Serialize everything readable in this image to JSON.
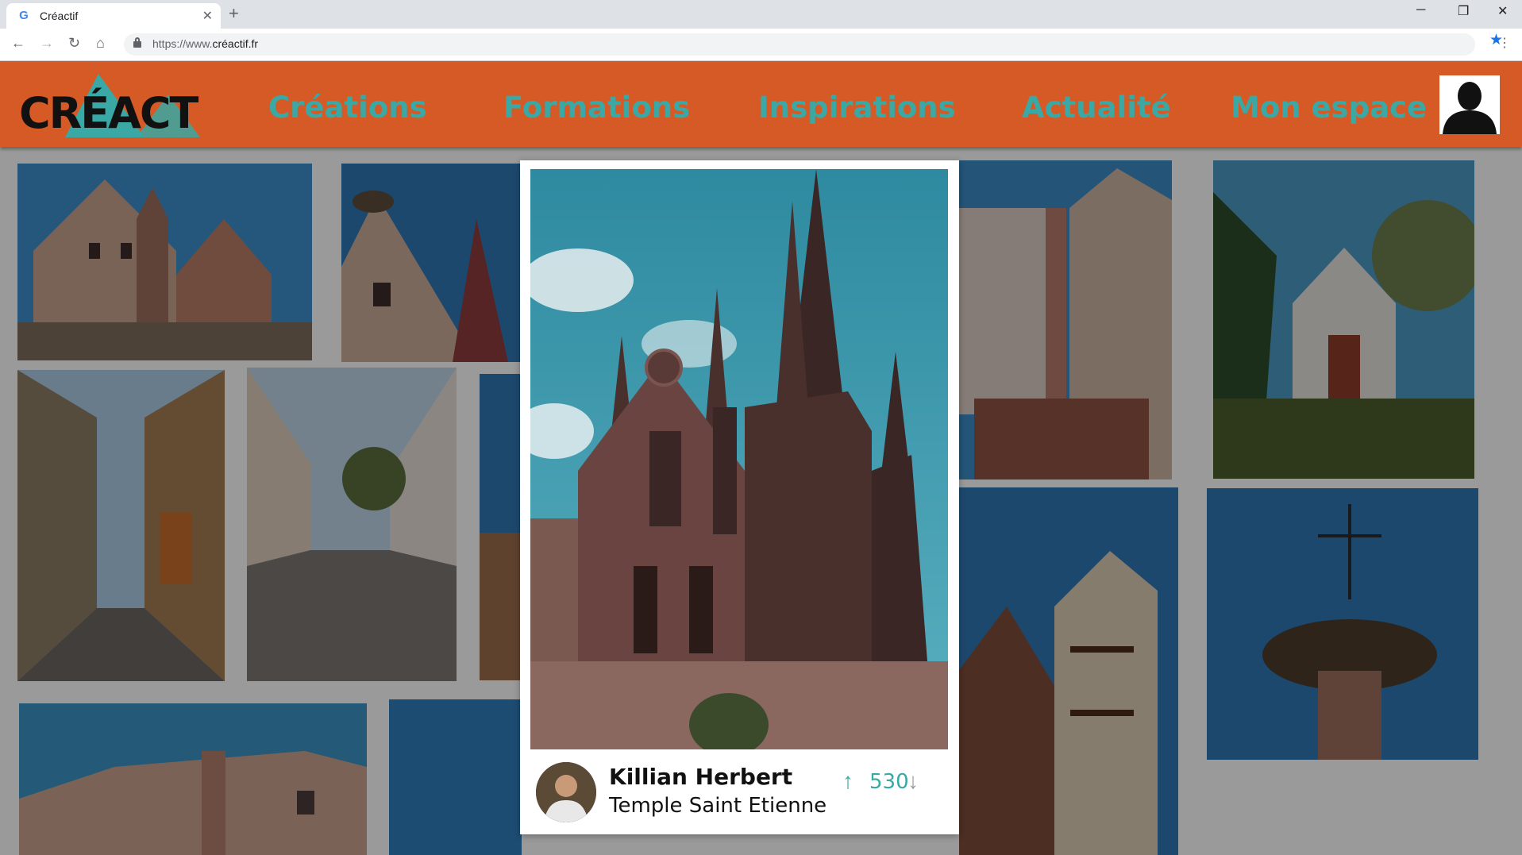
{
  "browser": {
    "tab_title": "Créactif",
    "favicon": "G",
    "url_prefix": "https://www.",
    "url_domain": "créactif.fr",
    "new_tab_symbol": "+",
    "close_symbol": "✕"
  },
  "site": {
    "logo_text": "CRÉACTIF",
    "nav": [
      "Créations",
      "Formations",
      "Inspirations",
      "Actualité",
      "Mon espace"
    ],
    "brand_color": "#d65a25",
    "accent_color": "#3aa8a4"
  },
  "featured": {
    "author": "Killian Herbert",
    "place": "Temple Saint Etienne",
    "votes": "530"
  },
  "icons": [
    "back-arrow-icon",
    "forward-arrow-icon",
    "reload-icon",
    "home-icon",
    "lock-icon",
    "star-icon",
    "menu-icon",
    "user-icon",
    "upvote-icon",
    "downvote-icon"
  ]
}
